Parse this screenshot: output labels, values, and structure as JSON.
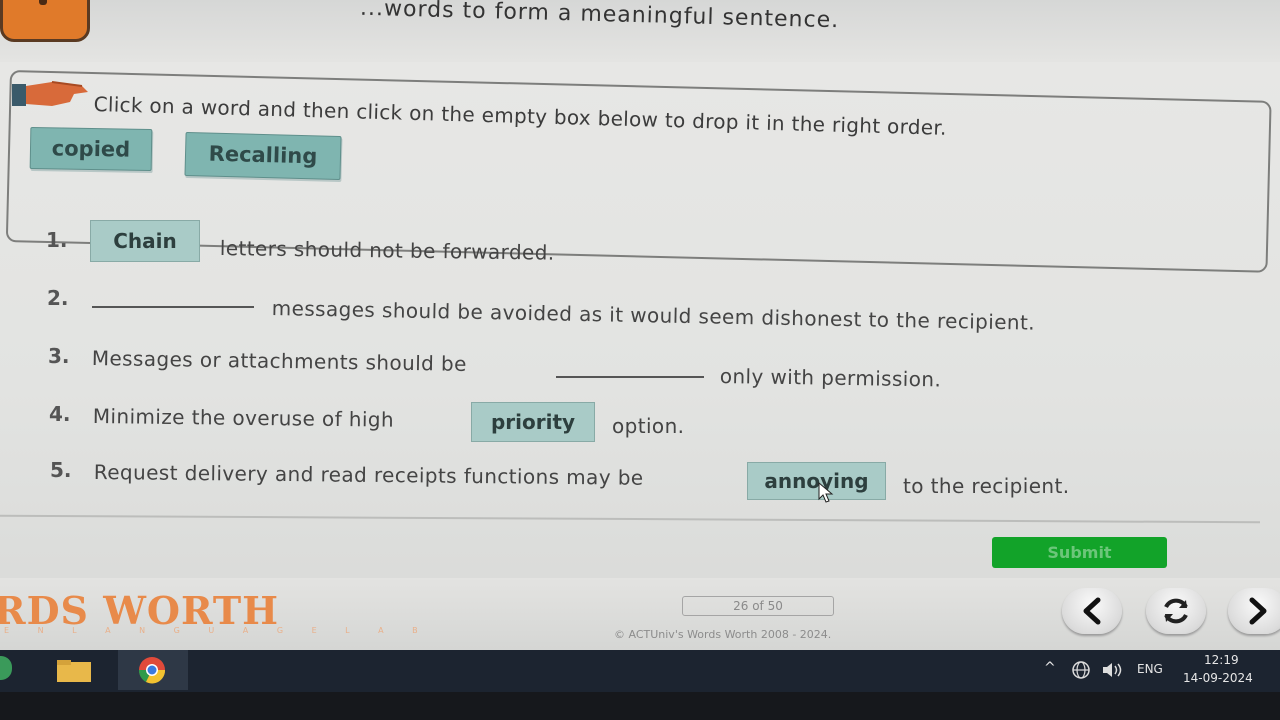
{
  "header": {
    "heading": "...words to form a meaningful sentence."
  },
  "instruction": "Click on a word and then click on the empty box below to drop it in the right order.",
  "word_bank": [
    "copied",
    "Recalling"
  ],
  "questions": [
    {
      "num": "1.",
      "answer": "Chain",
      "after": "letters should not be forwarded."
    },
    {
      "num": "2.",
      "answer": "",
      "after": "messages should be avoided as it would seem dishonest to the recipient."
    },
    {
      "num": "3.",
      "before": "Messages or attachments should be",
      "answer": "",
      "after": "only with permission."
    },
    {
      "num": "4.",
      "before": "Minimize the overuse of high",
      "answer": "priority",
      "after": "option."
    },
    {
      "num": "5.",
      "before": "Request delivery and read receipts functions may be",
      "answer": "annoying",
      "after": "to the recipient."
    }
  ],
  "submit_label": "Submit",
  "footer": {
    "logo": "RDS WORTH",
    "logo_sub": "E N L A N G U A G E L A B",
    "page_indicator": "26 of 50",
    "copyright": "© ACTUniv's Words Worth 2008 - 2024."
  },
  "taskbar": {
    "language": "ENG",
    "time": "12:19",
    "date": "14-09-2024"
  },
  "colors": {
    "chip": "#7fb5b0",
    "answer_box": "#a9cbc7",
    "submit": "#12a329",
    "logo": "#e88a4a"
  },
  "icons": [
    "hand-pointer-icon",
    "back-arrow-icon",
    "refresh-icon",
    "next-arrow-icon",
    "folder-icon",
    "chrome-icon",
    "globe-icon",
    "volume-icon",
    "chevron-up-icon"
  ]
}
